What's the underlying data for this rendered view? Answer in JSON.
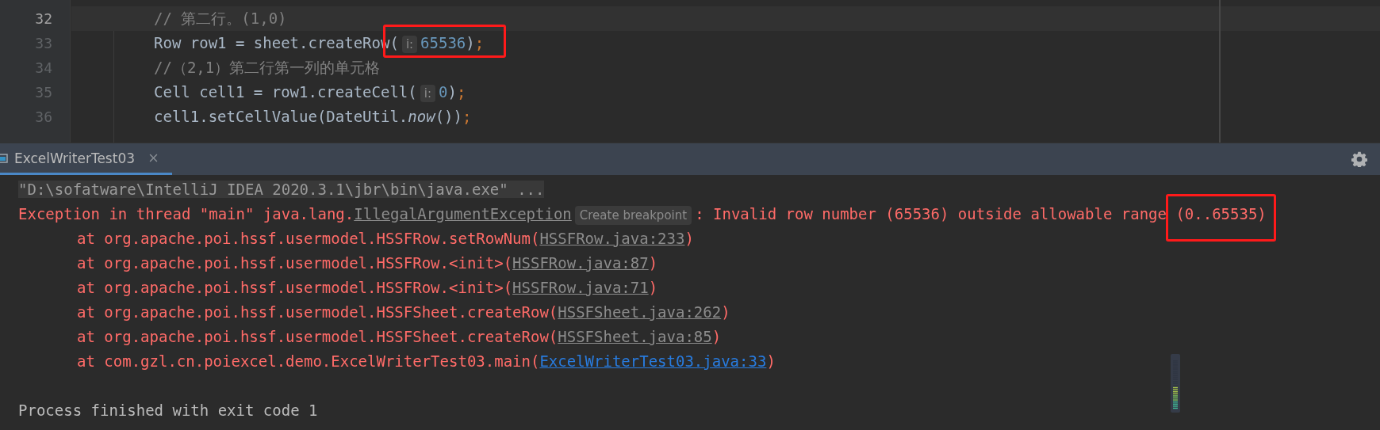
{
  "editor": {
    "lines": [
      {
        "number": "32",
        "current": true,
        "segments": [
          {
            "text": "// 第二行。(1,0)",
            "kind": "comment"
          }
        ]
      },
      {
        "number": "33",
        "current": false,
        "segments": [
          {
            "text": "Row row1 = sheet.createRow",
            "kind": "code"
          },
          {
            "text": "(",
            "kind": "code",
            "highlighted": true
          },
          {
            "text": "i:",
            "kind": "hint",
            "highlighted": true
          },
          {
            "text": "65536",
            "kind": "number",
            "highlighted": true
          },
          {
            "text": ")",
            "kind": "code",
            "highlighted": true
          },
          {
            "text": ";",
            "kind": "punct",
            "highlighted": true
          }
        ]
      },
      {
        "number": "34",
        "current": false,
        "segments": [
          {
            "text": "//（2,1）第二行第一列的单元格",
            "kind": "comment"
          }
        ]
      },
      {
        "number": "35",
        "current": false,
        "segments": [
          {
            "text": "Cell cell1 = row1.createCell(",
            "kind": "code"
          },
          {
            "text": "i:",
            "kind": "hint"
          },
          {
            "text": "0",
            "kind": "number"
          },
          {
            "text": ")",
            "kind": "code"
          },
          {
            "text": ";",
            "kind": "punct"
          }
        ]
      },
      {
        "number": "36",
        "current": false,
        "segments": [
          {
            "text": "cell1.setCellValue(DateUtil.",
            "kind": "code"
          },
          {
            "text": "now",
            "kind": "italic"
          },
          {
            "text": "())",
            "kind": "code"
          },
          {
            "text": ";",
            "kind": "punct"
          }
        ]
      }
    ]
  },
  "run_panel": {
    "tabs": [
      {
        "label": "ExcelWriterTest03",
        "selected": true,
        "closable": true
      }
    ],
    "console": [
      {
        "indented": false,
        "segments": [
          {
            "text": "\"D:\\sofatware\\IntelliJ IDEA 2020.3.1\\jbr\\bin\\java.exe\" ...",
            "kind": "command"
          }
        ]
      },
      {
        "indented": false,
        "segments": [
          {
            "text": "Exception in thread \"main\" java.lang.",
            "kind": "error"
          },
          {
            "text": "IllegalArgumentException",
            "kind": "link"
          },
          {
            "text": "Create breakpoint",
            "kind": "inlay"
          },
          {
            "text": ": Invalid row number (65536) outside allowable range ",
            "kind": "error"
          },
          {
            "text": "(0..65535)",
            "kind": "error",
            "highlighted": true
          }
        ]
      },
      {
        "indented": true,
        "segments": [
          {
            "text": "at org.apache.poi.hssf.usermodel.HSSFRow.setRowNum(",
            "kind": "error"
          },
          {
            "text": "HSSFRow.java:233",
            "kind": "link"
          },
          {
            "text": ")",
            "kind": "error"
          }
        ]
      },
      {
        "indented": true,
        "segments": [
          {
            "text": "at org.apache.poi.hssf.usermodel.HSSFRow.<init>(",
            "kind": "error"
          },
          {
            "text": "HSSFRow.java:87",
            "kind": "link"
          },
          {
            "text": ")",
            "kind": "error"
          }
        ]
      },
      {
        "indented": true,
        "segments": [
          {
            "text": "at org.apache.poi.hssf.usermodel.HSSFRow.<init>(",
            "kind": "error"
          },
          {
            "text": "HSSFRow.java:71",
            "kind": "link"
          },
          {
            "text": ")",
            "kind": "error"
          }
        ]
      },
      {
        "indented": true,
        "segments": [
          {
            "text": "at org.apache.poi.hssf.usermodel.HSSFSheet.createRow(",
            "kind": "error"
          },
          {
            "text": "HSSFSheet.java:262",
            "kind": "link"
          },
          {
            "text": ")",
            "kind": "error"
          }
        ]
      },
      {
        "indented": true,
        "segments": [
          {
            "text": "at org.apache.poi.hssf.usermodel.HSSFSheet.createRow(",
            "kind": "error"
          },
          {
            "text": "HSSFSheet.java:85",
            "kind": "link"
          },
          {
            "text": ")",
            "kind": "error"
          }
        ]
      },
      {
        "indented": true,
        "segments": [
          {
            "text": "at com.gzl.cn.poiexcel.demo.ExcelWriterTest03.main(",
            "kind": "error"
          },
          {
            "text": "ExcelWriterTest03.java:33",
            "kind": "project_link"
          },
          {
            "text": ")",
            "kind": "error"
          }
        ]
      },
      {
        "indented": false,
        "kind": "exit",
        "segments": [
          {
            "text": "Process finished with exit code 1",
            "kind": "plain"
          }
        ]
      }
    ]
  }
}
